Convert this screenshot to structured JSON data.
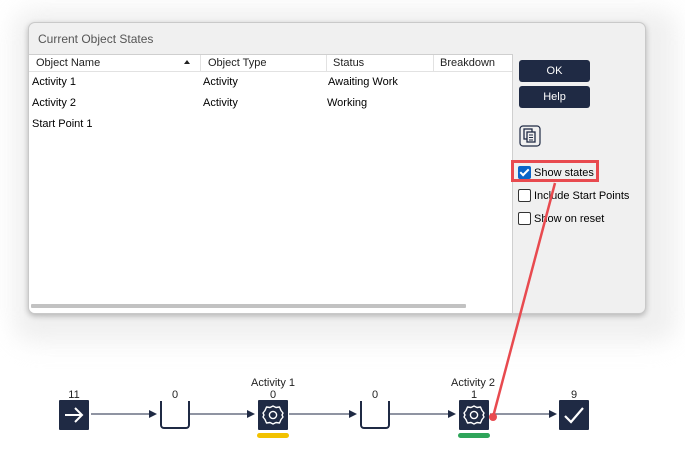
{
  "dialog": {
    "title": "Current Object States",
    "columns": [
      "Object Name",
      "Object Type",
      "Status",
      "Breakdown"
    ],
    "rows": [
      {
        "name": "Activity 1",
        "type": "Activity",
        "status": "Awaiting Work",
        "breakdown": ""
      },
      {
        "name": "Activity 2",
        "type": "Activity",
        "status": "Working",
        "breakdown": ""
      },
      {
        "name": "Start Point 1",
        "type": "",
        "status": "",
        "breakdown": ""
      }
    ],
    "ok_label": "OK",
    "help_label": "Help",
    "copy_icon": "copy-icon",
    "checkboxes": {
      "show_states": {
        "label": "Show states",
        "checked": true
      },
      "include_start_points": {
        "label": "Include Start Points",
        "checked": false
      },
      "show_on_reset": {
        "label": "Show on reset",
        "checked": false
      }
    },
    "sort_indicator": "ascending"
  },
  "flow": {
    "start": {
      "count": "11",
      "icon": "arrow-right-icon"
    },
    "queue1": {
      "count": "0"
    },
    "activity1": {
      "label": "Activity 1",
      "count": "0",
      "icon": "gear-icon",
      "status_color": "#f2c200"
    },
    "queue2": {
      "count": "0"
    },
    "activity2": {
      "label": "Activity 2",
      "count": "1",
      "icon": "gear-icon",
      "status_color": "#2fa55a"
    },
    "end": {
      "count": "9",
      "icon": "checkmark-icon"
    }
  },
  "annotation_color": "#e84a4f"
}
